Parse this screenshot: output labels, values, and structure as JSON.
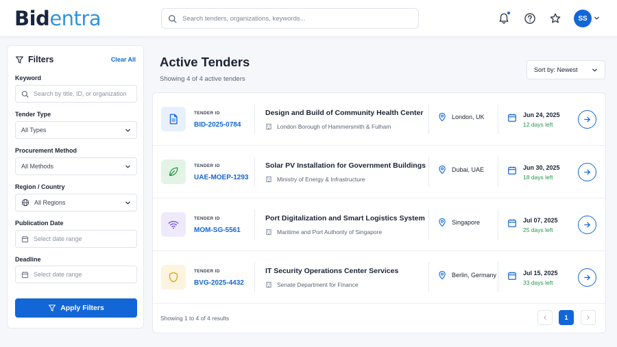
{
  "header": {
    "logo_part1": "Bid",
    "logo_part2": "entra",
    "search_placeholder": "Search tenders, organizations, keywords...",
    "avatar_initials": "SS"
  },
  "filters": {
    "title": "Filters",
    "clear_all": "Clear All",
    "keyword_label": "Keyword",
    "keyword_placeholder": "Search by title, ID, or organization",
    "tender_type_label": "Tender Type",
    "tender_type_value": "All Types",
    "procurement_label": "Procurement Method",
    "procurement_value": "All Methods",
    "region_label": "Region / Country",
    "region_value": "All Regions",
    "publication_label": "Publication Date",
    "publication_placeholder": "Select date range",
    "deadline_label": "Deadline",
    "deadline_placeholder": "Select date range",
    "apply_label": "Apply Filters"
  },
  "main": {
    "title": "Active Tenders",
    "subtitle": "Showing 4 of 4 active tenders",
    "sort_label": "Sort by: Newest",
    "tender_id_label": "TENDER ID",
    "tenders": [
      {
        "id": "BID-2025-0784",
        "title": "Design and Build of Community Health Center",
        "org": "London Borough of Hammersmith & Fulham",
        "location": "London, UK",
        "date": "Jun 24, 2025",
        "days_left": "12 days left",
        "icon": "document-icon",
        "icon_bg": "#e7f0fc",
        "icon_color": "#1366d6"
      },
      {
        "id": "UAE-MOEP-1293",
        "title": "Solar PV Installation for Government Buildings",
        "org": "Ministry of Energy & Infrastructure",
        "location": "Dubai, UAE",
        "date": "Jun 30, 2025",
        "days_left": "18 days left",
        "icon": "leaf-icon",
        "icon_bg": "#e3f4e7",
        "icon_color": "#2e9a4c"
      },
      {
        "id": "MOM-SG-5561",
        "title": "Port Digitalization and Smart Logistics System",
        "org": "Maritime and Port Authority of Singapore",
        "location": "Singapore",
        "date": "Jul 07, 2025",
        "days_left": "25 days left",
        "icon": "wifi-icon",
        "icon_bg": "#eeeafc",
        "icon_color": "#7b55e0"
      },
      {
        "id": "BVG-2025-4432",
        "title": "IT Security Operations Center Services",
        "org": "Senate Department for Finance",
        "location": "Berlin, Germany",
        "date": "Jul 15, 2025",
        "days_left": "33 days left",
        "icon": "shield-icon",
        "icon_bg": "#fdf4de",
        "icon_color": "#e0a21c"
      }
    ],
    "results_text": "Showing 1 to 4 of 4 results",
    "current_page": "1"
  },
  "colors": {
    "primary": "#1366d6",
    "success": "#1e9a4a"
  }
}
